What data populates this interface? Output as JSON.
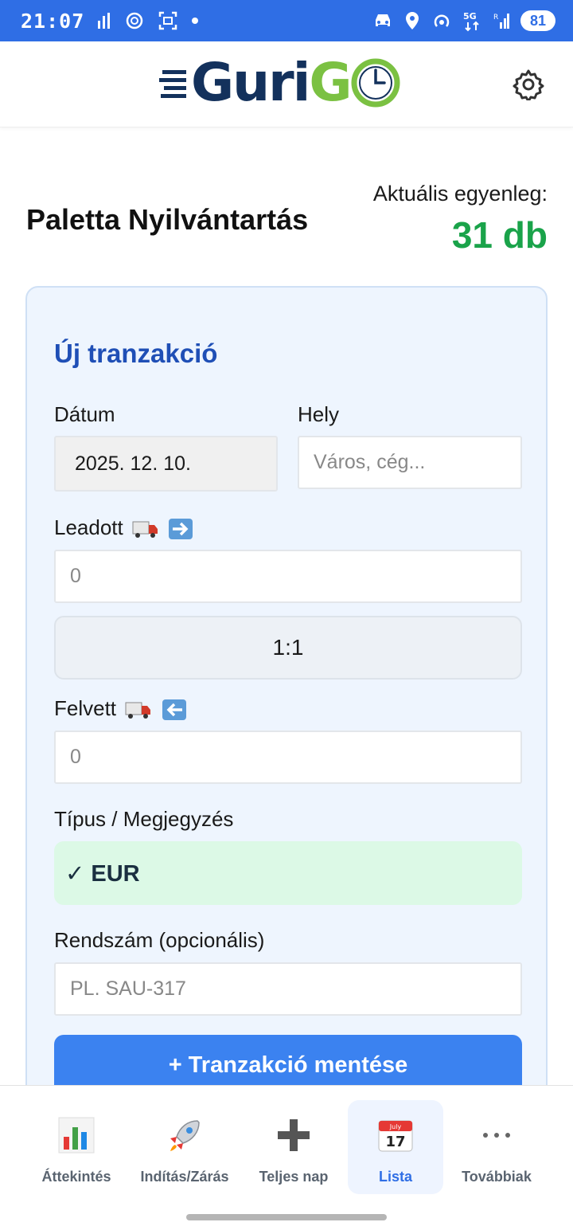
{
  "status_bar": {
    "time": "21:07",
    "network": "5G",
    "battery": "81"
  },
  "header": {
    "logo_left": "Guri",
    "logo_right": "G",
    "settings_icon": "gear-icon"
  },
  "page": {
    "title": "Paletta Nyilvántartás",
    "balance_label": "Aktuális egyenleg:",
    "balance_value": "31 db",
    "balance_color": "#1aa34a"
  },
  "form": {
    "title": "Új tranzakció",
    "date_label": "Dátum",
    "date_value": "2025. 12. 10.",
    "place_label": "Hely",
    "place_placeholder": "Város, cég...",
    "given_label": "Leadott",
    "given_placeholder": "0",
    "ratio": "1:1",
    "taken_label": "Felvett",
    "taken_placeholder": "0",
    "type_label": "Típus / Megjegyzés",
    "type_value": "✓ EUR",
    "plate_label": "Rendszám (opcionális)",
    "plate_placeholder": "PL. SAU-317",
    "save_label": "+ Tranzakció mentése",
    "accent": "#3b82f0"
  },
  "nav": {
    "items": [
      {
        "label": "Áttekintés",
        "icon": "bar-chart-icon"
      },
      {
        "label": "Indítás/Zárás",
        "icon": "rocket-icon"
      },
      {
        "label": "Teljes nap",
        "icon": "plus-icon"
      },
      {
        "label": "Lista",
        "icon": "calendar-icon",
        "active": true
      },
      {
        "label": "Továbbiak",
        "icon": "more-icon"
      }
    ],
    "calendar_month": "July",
    "calendar_day": "17"
  }
}
